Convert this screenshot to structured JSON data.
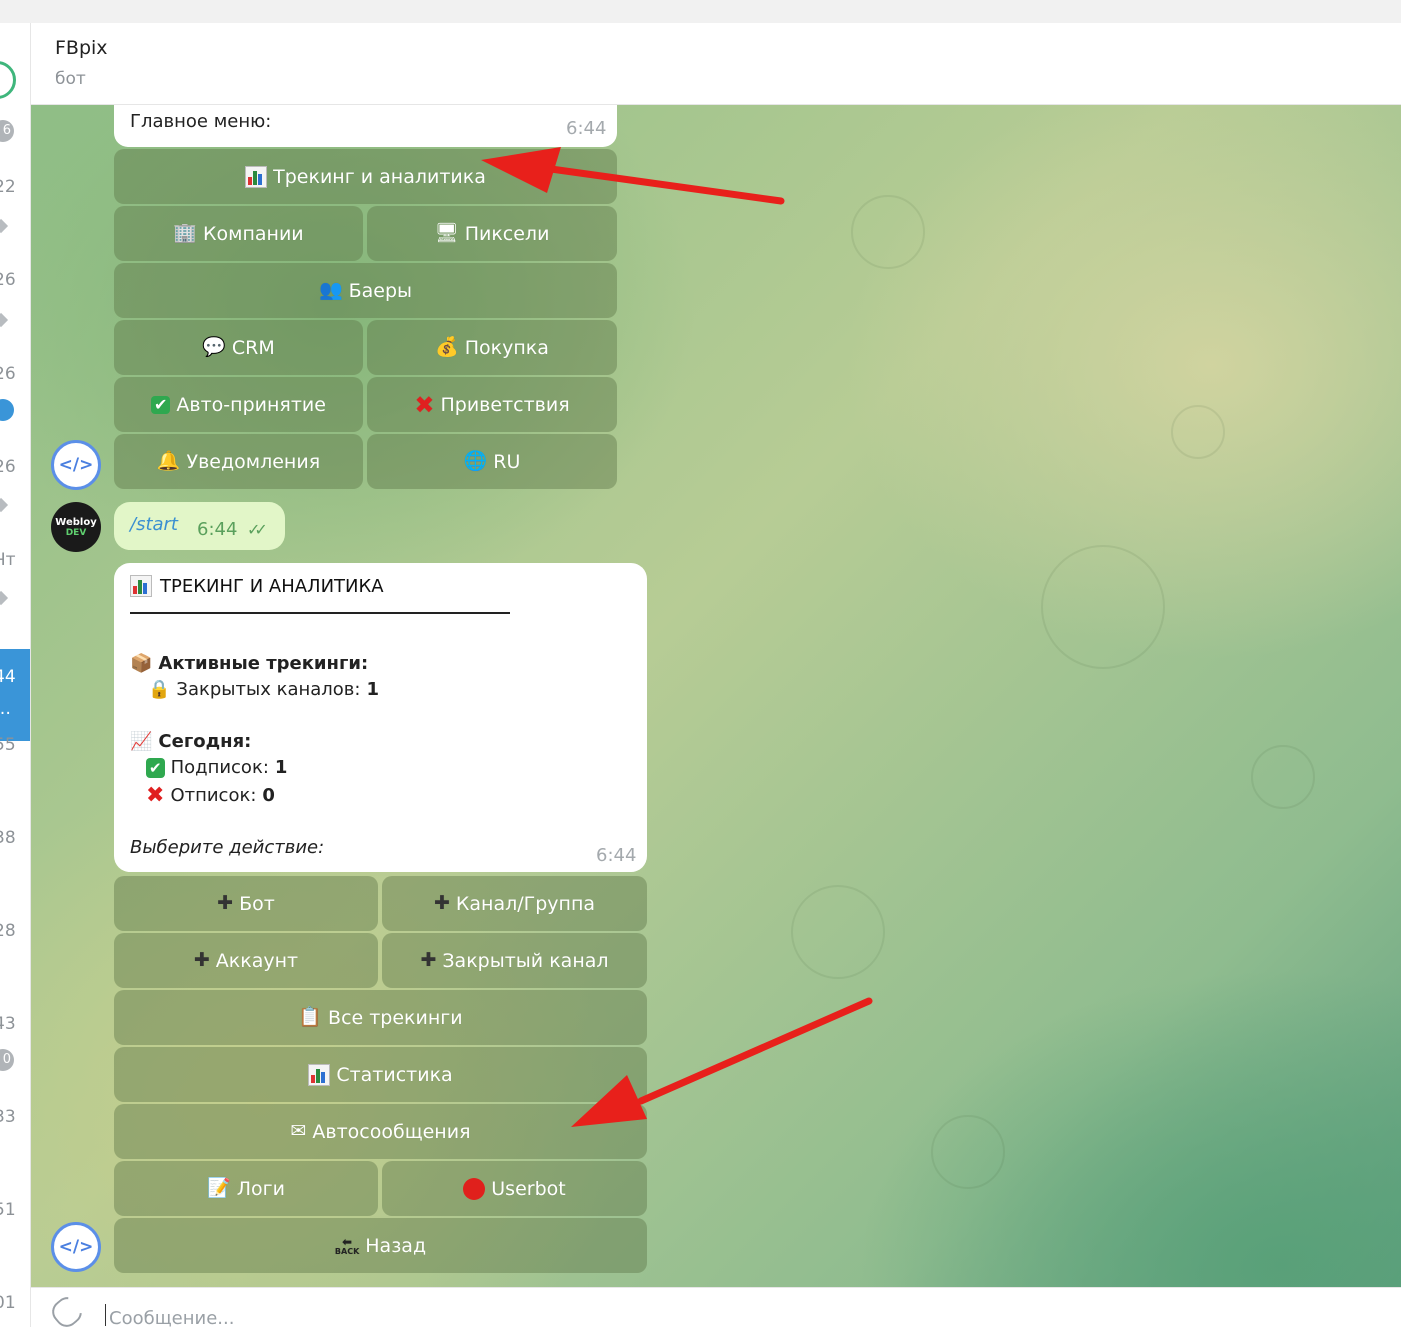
{
  "sidebar_strip": {
    "items": [
      {
        "text": "6",
        "kind": "badge"
      },
      {
        "text": "22",
        "kind": "num"
      },
      {
        "text": "26",
        "kind": "num"
      },
      {
        "text": "26",
        "kind": "num"
      },
      {
        "text": "26",
        "kind": "num"
      },
      {
        "text": "Чт",
        "kind": "num"
      },
      {
        "text": "44",
        "kind": "active"
      },
      {
        "text": "55",
        "kind": "num"
      },
      {
        "text": "38",
        "kind": "num"
      },
      {
        "text": "28",
        "kind": "num"
      },
      {
        "text": "43",
        "kind": "num"
      },
      {
        "text": "0",
        "kind": "badge"
      },
      {
        "text": "33",
        "kind": "num"
      },
      {
        "text": "51",
        "kind": "num"
      },
      {
        "text": "01",
        "kind": "num"
      }
    ]
  },
  "header": {
    "title": "FBpix",
    "subtitle": "бот"
  },
  "main_menu_message": {
    "text": "Главное меню:",
    "time": "6:44",
    "buttons": [
      {
        "label": "Трекинг и аналитика",
        "icon": "chart-icon"
      },
      {
        "label": "Компании",
        "icon": "office-building-icon"
      },
      {
        "label": "Пиксели",
        "icon": "monitor-icon"
      },
      {
        "label": "Баеры",
        "icon": "people-icon"
      },
      {
        "label": "CRM",
        "icon": "speech-bubble-icon"
      },
      {
        "label": "Покупка",
        "icon": "money-bag-icon"
      },
      {
        "label": "Авто-принятие",
        "icon": "check-mark-icon"
      },
      {
        "label": "Приветствия",
        "icon": "cross-mark-icon"
      },
      {
        "label": "Уведомления",
        "icon": "bell-icon"
      },
      {
        "label": "RU",
        "icon": "globe-icon"
      }
    ]
  },
  "outgoing_message": {
    "text": "/start",
    "time": "6:44",
    "ticks": "✓✓"
  },
  "avatars": {
    "bot_code_symbol": "</>",
    "user_name": "Webloy",
    "user_tag": "DEV"
  },
  "tracking_message": {
    "title": "ТРЕКИНГ И АНАЛИТИКА",
    "active_label": "Активные трекинги:",
    "closed_channels_label": "Закрытых каналов:",
    "closed_channels_value": "1",
    "today_label": "Сегодня:",
    "subs_label": "Подписок:",
    "subs_value": "1",
    "unsubs_label": "Отписок:",
    "unsubs_value": "0",
    "prompt": "Выберите действие:",
    "time": "6:44",
    "buttons": [
      {
        "label": "Бот",
        "icon": "plus-icon"
      },
      {
        "label": "Канал/Группа",
        "icon": "plus-icon"
      },
      {
        "label": "Аккаунт",
        "icon": "plus-icon"
      },
      {
        "label": "Закрытый канал",
        "icon": "plus-icon"
      },
      {
        "label": "Все трекинги",
        "icon": "clipboard-icon"
      },
      {
        "label": "Статистика",
        "icon": "chart-icon"
      },
      {
        "label": "Автосообщения",
        "icon": "envelope-icon"
      },
      {
        "label": "Логи",
        "icon": "memo-icon"
      },
      {
        "label": "Userbot",
        "icon": "red-circle-icon"
      },
      {
        "label": "Назад",
        "icon": "back-arrow-icon"
      }
    ]
  },
  "input": {
    "placeholder": "Сообщение..."
  },
  "colors": {
    "annotation_arrow": "#e8201b",
    "accent_blue": "#3a95d8",
    "outgoing_bubble": "#e2f6c8"
  }
}
